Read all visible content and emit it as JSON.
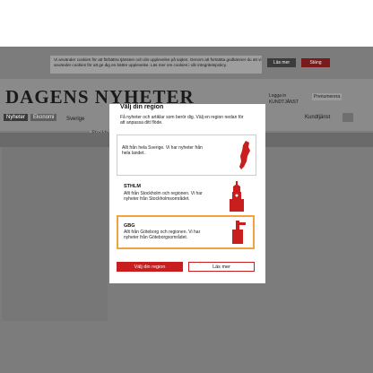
{
  "cookie_banner": {
    "text": "Vi använder cookies för att förbättra tjänsten och din upplevelse på sajten. Genom att fortsätta godkänner du att vi använder cookies för att ge dig en bättre upplevelse. Läs mer om cookies i vår integritetspolicy.",
    "accept_label": "Läs mer",
    "close_label": "Stäng"
  },
  "site": {
    "logo": "DAGENS NYHETER",
    "nav_tabs": [
      "Nyheter",
      "Ekonomi"
    ],
    "sub_link_1": "Sverige",
    "sub_link_2": "Stockholm",
    "right_text": "Logga in\nKUNDTJÄNST",
    "right_button": "Prenumerera",
    "right_text2": "Kundtjänst"
  },
  "popup": {
    "heading": "Välj din region",
    "intro": "Få nyheter och artiklar som berör dig. Välj en region nedan för att anpassa ditt flöde.",
    "region_card_text": "Allt från hela Sverige. Vi har nyheter från hela landet.",
    "sthlm": {
      "title": "STHLM",
      "text": "Allt från Stockholm och regionen. Vi har nyheter från Stockholmsområdet."
    },
    "gbg": {
      "title": "GBG",
      "text": "Allt från Göteborg och regionen. Vi har nyheter från Göteborgsområdet."
    },
    "select_label": "Välj din region",
    "read_more_label": "Läs mer"
  },
  "colors": {
    "accent": "#c81e1e",
    "highlight": "#f2a33a",
    "dim": "#7c7c7c"
  }
}
